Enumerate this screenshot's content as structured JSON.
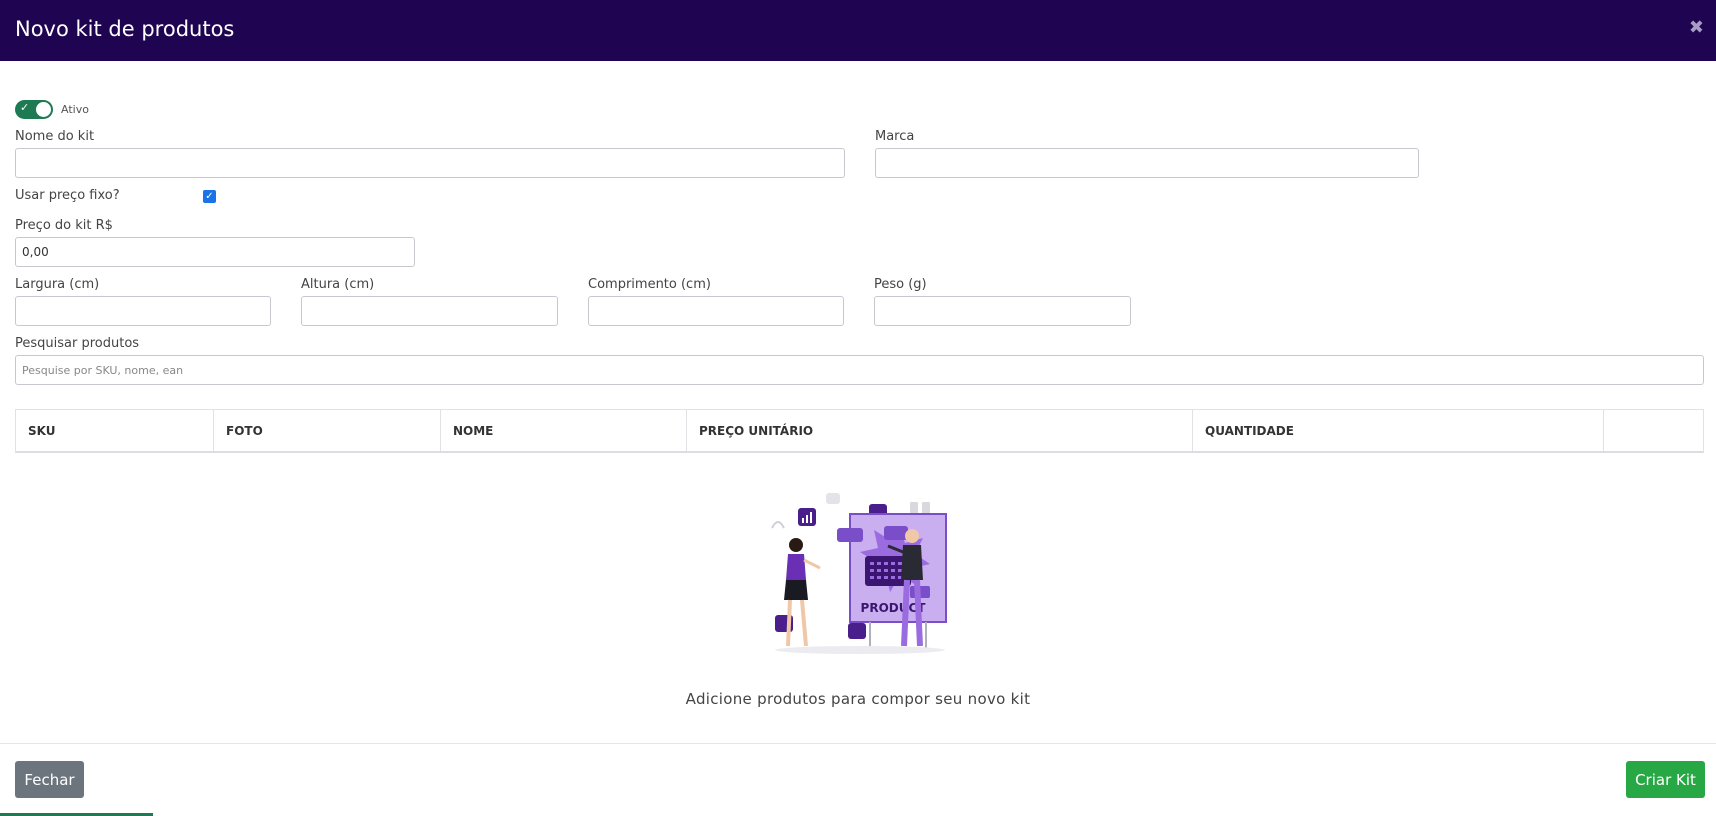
{
  "modal": {
    "title": "Novo kit de produtos",
    "close_icon": "close-icon"
  },
  "form": {
    "active_label": "Ativo",
    "active": true,
    "kit_name_label": "Nome do kit",
    "kit_name_value": "",
    "brand_label": "Marca",
    "brand_value": "",
    "fixed_price_label": "Usar preço fixo?",
    "fixed_price_checked": true,
    "kit_price_label": "Preço do kit R$",
    "kit_price_value": "0,00",
    "width_label": "Largura (cm)",
    "height_label": "Altura (cm)",
    "length_label": "Comprimento (cm)",
    "weight_label": "Peso (g)",
    "search_label": "Pesquisar produtos",
    "search_placeholder": "Pesquise por SKU, nome, ean"
  },
  "table": {
    "columns": [
      "SKU",
      "FOTO",
      "NOME",
      "PREÇO UNITÁRIO",
      "QUANTIDADE",
      ""
    ]
  },
  "empty_state": {
    "illustration_text": "PRODUCT",
    "message": "Adicione produtos para compor seu novo kit"
  },
  "footer": {
    "close_label": "Fechar",
    "create_label": "Criar Kit"
  },
  "colors": {
    "header_bg": "#1f0551",
    "toggle_on": "#1e7a52",
    "close_button": "#6c757d",
    "create_button": "#28a745",
    "accent_purple": "#6a2fb5"
  }
}
